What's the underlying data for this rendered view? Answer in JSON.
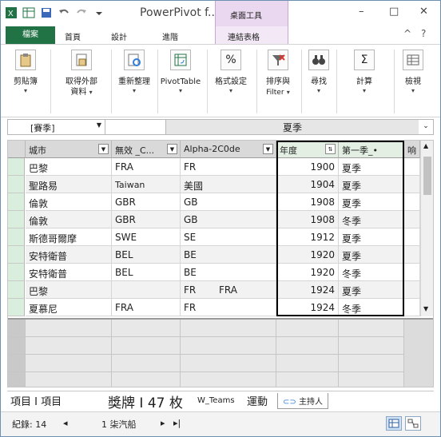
{
  "titlebar": {
    "app_title": "PowerPivot f...",
    "context_group": "桌面工具",
    "minimize": "–",
    "restore": "□",
    "close": "✕",
    "help": "?"
  },
  "tabs": {
    "file": "檔案",
    "home": "首頁",
    "design": "設計",
    "advanced": "進階",
    "linked_table": "連結表格"
  },
  "ribbon": {
    "clipboard": {
      "label": "剪貼簿",
      "icon": "clipboard-icon"
    },
    "get_external": {
      "label1": "取得外部",
      "label2": "資料",
      "icon": "database-icon"
    },
    "refresh": {
      "label": "重新整理",
      "icon": "refresh-icon"
    },
    "pivot": {
      "label": "PivotTable",
      "icon": "pivottable-icon"
    },
    "format": {
      "label": "格式設定",
      "icon": "percent-icon"
    },
    "sort": {
      "label1": "排序與",
      "label2": "Filter",
      "icon": "filter-clear-icon"
    },
    "find": {
      "label": "尋找",
      "icon": "binoculars-icon"
    },
    "calc": {
      "label": "計算",
      "icon": "sigma-icon"
    },
    "view": {
      "label": "檢視",
      "icon": "grid-view-icon"
    }
  },
  "formula_bar": {
    "name_box": "[賽季]",
    "content": "夏季"
  },
  "grid": {
    "columns": [
      {
        "label": "城市"
      },
      {
        "label": "無效 _C..."
      },
      {
        "label": "Alpha-2C0de"
      },
      {
        "label": "年度"
      },
      {
        "label": "第一季_•"
      },
      {
        "label": "响"
      }
    ],
    "rows": [
      [
        "巴黎",
        "FRA",
        "FR",
        "1900",
        "夏季"
      ],
      [
        "聖路易",
        "Taiwan",
        "美國",
        "1904",
        "夏季"
      ],
      [
        "倫敦",
        "GBR",
        "GB",
        "1908",
        "夏季"
      ],
      [
        "倫敦",
        "GBR",
        "GB",
        "1908",
        "冬季"
      ],
      [
        "斯德哥爾摩",
        "SWE",
        "SE",
        "1912",
        "夏季"
      ],
      [
        "安特衛普",
        "BEL",
        "BE",
        "1920",
        "夏季"
      ],
      [
        "安特衛普",
        "BEL",
        "BE",
        "1920",
        "冬季"
      ],
      [
        "巴黎",
        "",
        "FR",
        "1924",
        "夏季"
      ],
      [
        "夏慕尼",
        "FRA",
        "FR",
        "1924",
        "冬季"
      ]
    ],
    "extra_fra": "FRA"
  },
  "sheets": {
    "tab1": "項目 I 項目",
    "tab2": "獎牌 I 47 枚",
    "tab3": "W_Teams",
    "tab4": "運動",
    "tab5": "主持人"
  },
  "status": {
    "records_label": "紀錄: 14",
    "record_position": "1 柒汽船",
    "nav_first": "◂",
    "nav_prev": "◂",
    "nav_next": "▸",
    "nav_last": "▸|"
  }
}
